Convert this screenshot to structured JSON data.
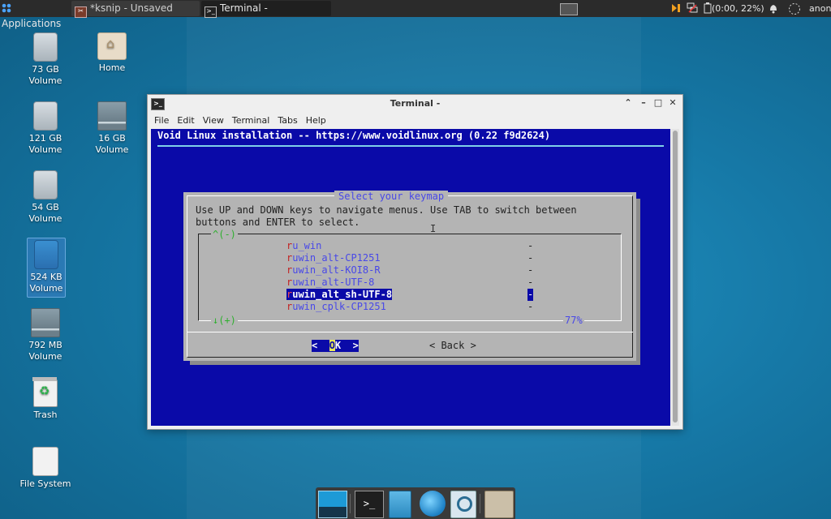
{
  "top_panel": {
    "applications_label": "Applications",
    "tasks": [
      {
        "label": "*ksnip - Unsaved",
        "icon": "ksnip-icon"
      },
      {
        "label": "Terminal -",
        "icon": "terminal-icon"
      }
    ],
    "battery_label": "(0:00, 22%)",
    "user_label": "anon"
  },
  "desktop_icons": [
    {
      "label": "73 GB\nVolume",
      "line1": "73 GB",
      "line2": "Volume"
    },
    {
      "label": "Home"
    },
    {
      "line1": "121 GB",
      "line2": "Volume"
    },
    {
      "line1": "16 GB",
      "line2": "Volume"
    },
    {
      "line1": "54 GB",
      "line2": "Volume"
    },
    {
      "line1": "524 KB",
      "line2": "Volume"
    },
    {
      "line1": "792 MB",
      "line2": "Volume"
    },
    {
      "label": "Trash"
    },
    {
      "label": "File System"
    }
  ],
  "terminal": {
    "title": "Terminal -",
    "menu": [
      "File",
      "Edit",
      "View",
      "Terminal",
      "Tabs",
      "Help"
    ],
    "header": "Void Linux installation -- https://www.voidlinux.org (0.22 f9d2624)",
    "dialog": {
      "title": "Select your keymap",
      "prompt_line1": "Use UP and DOWN keys to navigate menus. Use TAB to switch between",
      "prompt_line2": "buttons and ENTER to select.",
      "scroll_up": "^(-)",
      "scroll_down": "↓(+)",
      "scroll_percent": "77%",
      "items": [
        {
          "key": "r",
          "rest": "u_win",
          "desc": "-"
        },
        {
          "key": "r",
          "rest": "uwin_alt-CP1251",
          "desc": "-"
        },
        {
          "key": "r",
          "rest": "uwin_alt-KOI8-R",
          "desc": "-"
        },
        {
          "key": "r",
          "rest": "uwin_alt-UTF-8",
          "desc": "-"
        },
        {
          "key": "r",
          "rest": "uwin_alt_sh-UTF-8",
          "desc": "-",
          "selected": true
        },
        {
          "key": "r",
          "rest": "uwin_cplk-CP1251",
          "desc": "-"
        }
      ],
      "ok_pre": "<  ",
      "ok_hotkey": "O",
      "ok_post": "K  >",
      "back_label": "< Back >"
    }
  },
  "dock": [
    "show-desktop",
    "terminal",
    "file-manager",
    "web-browser",
    "app-finder",
    "home-folder"
  ],
  "colors": {
    "terminal_bg": "#0a0aa8",
    "dialog_bg": "#b4b4b4",
    "title_text": "#4848e8",
    "hotkey": "#c21f1f"
  }
}
